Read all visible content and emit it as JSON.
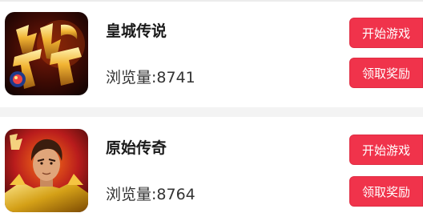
{
  "games": [
    {
      "title": "皇城传说",
      "views": "浏览量:8741",
      "thumbnail_icon": "chuanqi-calligraphy-logo-icon",
      "start_label": "开始游戏",
      "reward_label": "领取奖励"
    },
    {
      "title": "原始传奇",
      "views": "浏览量:8764",
      "thumbnail_icon": "armored-warrior-portrait-icon",
      "start_label": "开始游戏",
      "reward_label": "领取奖励"
    }
  ],
  "colors": {
    "button_bg": "#f0334b",
    "button_text": "#ffffff",
    "title_text": "#1a1a1a",
    "views_text": "#333333",
    "separator": "#f3f3f3"
  }
}
